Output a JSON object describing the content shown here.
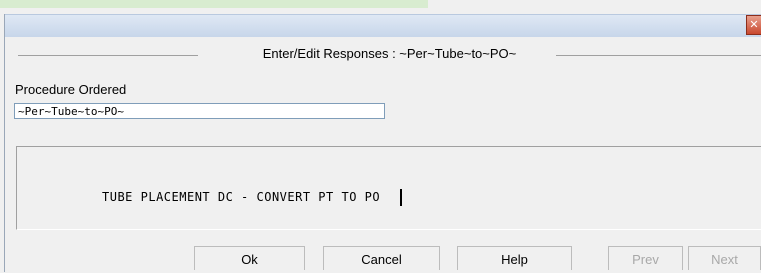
{
  "window": {
    "close_glyph": "✕"
  },
  "dialog": {
    "group_title": "Enter/Edit Responses : ~Per~Tube~to~PO~"
  },
  "procedure": {
    "label": "Procedure Ordered",
    "value": "~Per~Tube~to~PO~"
  },
  "response_text": "TUBE PLACEMENT DC - CONVERT PT TO PO",
  "buttons": {
    "ok": "Ok",
    "cancel": "Cancel",
    "help": "Help",
    "prev": "Prev",
    "next": "Next"
  },
  "colors": {
    "background": "#f0f0f0",
    "titlebar": "#c7d6ea",
    "close_button": "#c9482e",
    "disabled_text": "#a8a8a8"
  }
}
